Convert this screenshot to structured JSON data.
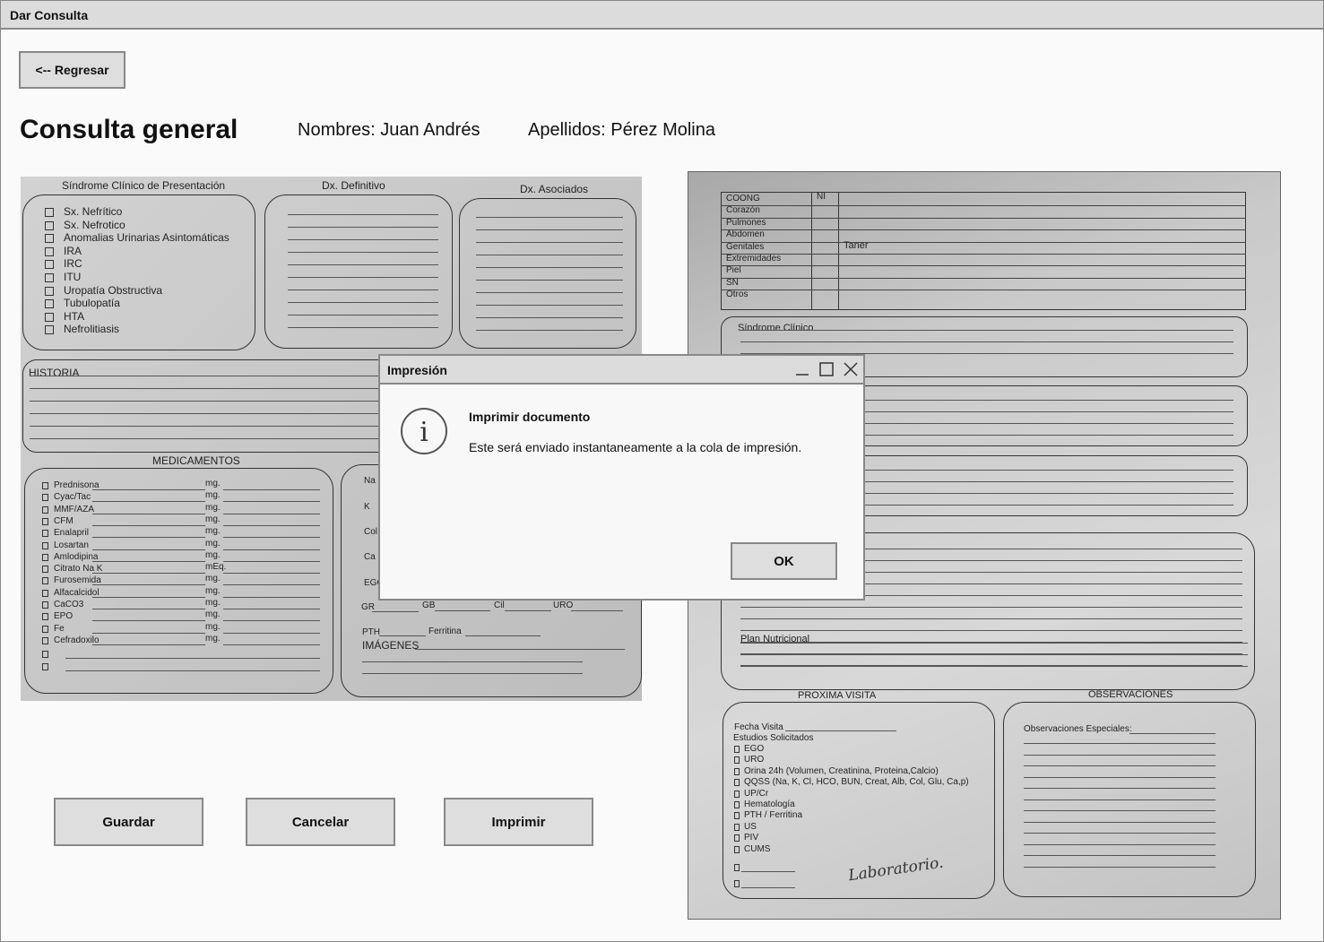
{
  "window": {
    "title": "Dar Consulta"
  },
  "nav": {
    "back_label": "<-- Regresar"
  },
  "header": {
    "title": "Consulta general",
    "nombres": "Nombres: Juan Andrés",
    "apellidos": "Apellidos: Pérez Molina"
  },
  "scan_left": {
    "sindrome_title": "Síndrome Clínico de Presentación",
    "sindrome_items": [
      "Sx. Nefrítico",
      "Sx. Nefrotico",
      "Anomalias Urinarias Asintomáticas",
      "IRA",
      "IRC",
      "ITU",
      "Uropatía Obstructiva",
      "Tubulopatía",
      "HTA",
      "Nefrolitiasis"
    ],
    "dx_definitivo": "Dx. Definitivo",
    "dx_asociados": "Dx. Asociados",
    "historia": "HISTORIA",
    "medicamentos_title": "MEDICAMENTOS",
    "medicamentos": [
      {
        "name": "Prednisona",
        "unit": "mg."
      },
      {
        "name": "Cyac/Tac",
        "unit": "mg."
      },
      {
        "name": "MMF/AZA",
        "unit": "mg."
      },
      {
        "name": "CFM",
        "unit": "mg."
      },
      {
        "name": "Enalapril",
        "unit": "mg."
      },
      {
        "name": "Losartan",
        "unit": "mg."
      },
      {
        "name": "Amlodipina",
        "unit": "mg."
      },
      {
        "name": "Citrato Na K",
        "unit": "mEq."
      },
      {
        "name": "Furosemida",
        "unit": "mg."
      },
      {
        "name": "Alfacalcidol",
        "unit": "mg."
      },
      {
        "name": "CaCO3",
        "unit": "mg."
      },
      {
        "name": "EPO",
        "unit": "mg."
      },
      {
        "name": "Fe",
        "unit": "mg."
      },
      {
        "name": "Cefradoxilo",
        "unit": "mg."
      }
    ],
    "labs": [
      "Na",
      "K",
      "Col",
      "Ca",
      "EGO"
    ],
    "labs_row_gr": "GR",
    "labs_row_gb": "GB",
    "labs_row_cil": "Cil",
    "labs_row_uro": "URO",
    "labs_pth": "PTH",
    "labs_ferritina": "Ferritina",
    "imagenes": "IMÁGENES"
  },
  "scan_right": {
    "exam_rows": [
      "COONG",
      "Corazón",
      "Pulmones",
      "Abdomen",
      "Genitales",
      "Extremidades",
      "Piel",
      "SN",
      "Otros"
    ],
    "exam_col_header": "NI",
    "genitales_note": "Taner",
    "sindrome_clinico": "Síndrome Clínico",
    "plan_nutricional": "Plan Nutricional",
    "proxima_visita": "PROXIMA VISITA",
    "observaciones": "OBSERVACIONES",
    "fecha_visita": "Fecha Visita",
    "estudios_solicitados": "Estudios Solicitados",
    "estudios": [
      "EGO",
      "URO",
      "Orina 24h (Volumen, Creatinina,  Proteina,Calcio)",
      "QQSS (Na, K, Cl, HCO, BUN, Creat, Alb, Col, Glu, Ca,p)",
      "UP/Cr",
      "Hematología",
      "PTH / Ferritina",
      "US",
      "PIV",
      "CUMS"
    ],
    "observaciones_especiales": "Observaciones Especiales:",
    "handwriting": "Laboratorio."
  },
  "actions": {
    "guardar": "Guardar",
    "cancelar": "Cancelar",
    "imprimir": "Imprimir"
  },
  "modal": {
    "title": "Impresión",
    "heading": "Imprimir documento",
    "message": "Este será enviado instantaneamente a la cola de impresión.",
    "ok_label": "OK",
    "icon": "info-icon"
  }
}
